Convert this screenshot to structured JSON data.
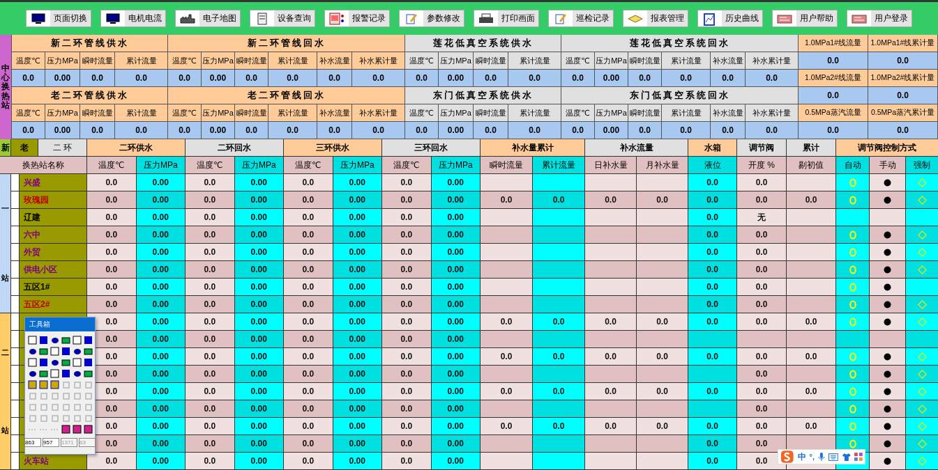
{
  "toolbar": {
    "buttons": [
      "页面切换",
      "电机电流",
      "电子地图",
      "设备查询",
      "报警记录",
      "参数修改",
      "打印画面",
      "巡检记录",
      "报表管理",
      "历史曲线",
      "用户帮助",
      "用户登录"
    ]
  },
  "top_panel": {
    "side_label": "中心换热站",
    "bands": [
      {
        "sections": [
          {
            "title": "新二环管线供水",
            "color": "#ffcc99",
            "columns": [
              "温度℃",
              "压力MPa",
              "瞬时流量",
              "累计流量"
            ],
            "values": [
              "0.0",
              "0.00",
              "0.0",
              "0.0"
            ]
          },
          {
            "title": "新二环管线回水",
            "color": "#ffcc99",
            "columns": [
              "温度℃",
              "压力MPa",
              "瞬时流量",
              "累计流量",
              "补水流量",
              "补水累计量"
            ],
            "values": [
              "0.0",
              "0.00",
              "0.0",
              "0.0",
              "0.0",
              "0.0"
            ]
          },
          {
            "title": "莲花低真空系统供水",
            "color": "#e0e0e0",
            "columns": [
              "温度℃",
              "压力MPa",
              "瞬时流量",
              "累计流量"
            ],
            "values": [
              "0.0",
              "0.00",
              "0.0",
              "0.0"
            ]
          },
          {
            "title": "莲花低真空系统回水",
            "color": "#e0e0e0",
            "columns": [
              "温度℃",
              "压力MPa",
              "瞬时流量",
              "累计流量",
              "补水流量",
              "补水累计量"
            ],
            "values": [
              "0.0",
              "0.00",
              "0.0",
              "0.0",
              "0.0",
              "0.0"
            ]
          }
        ]
      },
      {
        "sections": [
          {
            "title": "老二环管线供水",
            "color": "#ffcc99",
            "columns": [
              "温度℃",
              "压力MPa",
              "瞬时流量",
              "累计流量"
            ],
            "values": [
              "0.0",
              "0.00",
              "0.0",
              "0.0"
            ]
          },
          {
            "title": "老二环管线回水",
            "color": "#ffcc99",
            "columns": [
              "温度℃",
              "压力MPa",
              "瞬时流量",
              "累计流量",
              "补水流量",
              "补水累计量"
            ],
            "values": [
              "0.0",
              "0.00",
              "0.0",
              "0.0",
              "0.0",
              "0.0"
            ]
          },
          {
            "title": "东门低真空系统供水",
            "color": "#e0e0e0",
            "columns": [
              "温度℃",
              "压力MPa",
              "瞬时流量",
              "累计流量"
            ],
            "values": [
              "0.0",
              "0.00",
              "0.0",
              "0.0"
            ]
          },
          {
            "title": "东门低真空系统回水",
            "color": "#e0e0e0",
            "columns": [
              "温度℃",
              "压力MPa",
              "瞬时流量",
              "累计流量",
              "补水流量",
              "补水累计量"
            ],
            "values": [
              "0.0",
              "0.00",
              "0.0",
              "0.0",
              "0.0",
              "0.0"
            ]
          }
        ]
      }
    ],
    "extras": [
      {
        "labels": [
          "1.0MPa1#线流量",
          "1.0MPa1#线累计量"
        ],
        "values": [
          "0.0",
          "0.0"
        ]
      },
      {
        "labels": [
          "1.0MPa2#线流量",
          "1.0MPa2#线累计量"
        ],
        "values": [
          "0.0",
          "0.0"
        ]
      },
      {
        "labels": [
          "0.5MPa蒸汽流量",
          "0.5MPa蒸汽累计量"
        ],
        "values": [
          "0.0",
          "0.0"
        ]
      }
    ]
  },
  "station_table": {
    "ring_tabs": [
      {
        "label": "新",
        "color": "#99cc33"
      },
      {
        "label": "老",
        "color": "#999900"
      },
      {
        "label": "二 环",
        "color": "#e0e0e0"
      }
    ],
    "name_header": "换热站名称",
    "header_groups": [
      {
        "title": "二环供水",
        "color": "#ffcc99",
        "columns": [
          "温度℃",
          "压力MPa"
        ]
      },
      {
        "title": "二环回水",
        "color": "#e0e0e0",
        "columns": [
          "温度℃",
          "压力MPa"
        ]
      },
      {
        "title": "三环供水",
        "color": "#ffcc99",
        "columns": [
          "温度℃",
          "压力MPa"
        ]
      },
      {
        "title": "三环回水",
        "color": "#e0e0e0",
        "columns": [
          "温度℃",
          "压力MPa"
        ]
      },
      {
        "title": "补水量累计",
        "color": "#ffcc99",
        "columns": [
          "瞬时流量",
          "累计流量"
        ]
      },
      {
        "title": "补水流量",
        "color": "#e0e0e0",
        "columns": [
          "日补水量",
          "月补水量"
        ]
      },
      {
        "title": "水箱",
        "color": "#ffcc99",
        "columns": [
          "液位"
        ]
      },
      {
        "title": "调节阀",
        "color": "#e0e0e0",
        "columns": [
          "开度 %"
        ]
      },
      {
        "title": "累计",
        "color": "#e0e0e0",
        "columns": [
          "剔初值"
        ]
      },
      {
        "title": "调节阀控制方式",
        "color": "#ffcc99",
        "columns": [
          "自动",
          "手动",
          "强制"
        ]
      }
    ],
    "groups": [
      {
        "label_top": "一",
        "label_bottom": "站",
        "color": "#c0d8f8",
        "rows": [
          {
            "name": "兴盛",
            "color": "#800080",
            "readings": [
              "0.0",
              "0.00",
              "0.0",
              "0.00",
              "0.0",
              "0.00",
              "0.0",
              "0.00"
            ],
            "tank_level": "0.0",
            "valve_opening": "0.0",
            "auto": true,
            "manual": true,
            "forced": true
          },
          {
            "name": "玫瑰园",
            "color": "#c00000",
            "readings": [
              "0.0",
              "0.00",
              "0.0",
              "0.00",
              "0.0",
              "0.00",
              "0.0",
              "0.00"
            ],
            "makeup_instant": "0.0",
            "makeup_total": "0.0",
            "daily_makeup": "0.0",
            "monthly_makeup": "0.0",
            "tank_level": "0.0",
            "valve_opening": "0.0",
            "initial_value": "0.0",
            "auto": true,
            "manual": true,
            "forced": true
          },
          {
            "name": "辽建",
            "color": "#000000",
            "readings": [
              "0.0",
              "0.00",
              "0.0",
              "0.00",
              "0.0",
              "0.00",
              "0.0",
              "0.00"
            ],
            "tank_level": "0.0",
            "valve_opening": "无",
            "auto": false,
            "manual": false,
            "forced": false
          },
          {
            "name": "六中",
            "color": "#800080",
            "readings": [
              "0.0",
              "0.00",
              "0.0",
              "0.00",
              "0.0",
              "0.00",
              "0.0",
              "0.00"
            ],
            "tank_level": "0.0",
            "valve_opening": "0.0",
            "auto": true,
            "manual": true,
            "forced": true
          },
          {
            "name": "外贸",
            "color": "#800080",
            "readings": [
              "0.0",
              "0.00",
              "0.0",
              "0.00",
              "0.0",
              "0.00",
              "0.0",
              "0.00"
            ],
            "tank_level": "0.0",
            "valve_opening": "0.0",
            "auto": true,
            "manual": true,
            "forced": true
          },
          {
            "name": "供电小区",
            "color": "#800080",
            "readings": [
              "0.0",
              "0.00",
              "0.0",
              "0.00",
              "0.0",
              "0.00",
              "0.0",
              "0.00"
            ],
            "tank_level": "0.0",
            "valve_opening": "0.0",
            "auto": true,
            "manual": true,
            "forced": true
          },
          {
            "name": "五区1#",
            "color": "#000000",
            "readings": [
              "0.0",
              "0.00",
              "0.0",
              "0.00",
              "0.0",
              "0.00",
              "0.0",
              "0.00"
            ],
            "tank_level": "0.0",
            "valve_opening": "0.0",
            "auto": true,
            "manual": true,
            "forced": false
          },
          {
            "name": "五区2#",
            "color": "#c00000",
            "readings": [
              "0.0",
              "0.00",
              "0.0",
              "0.00",
              "0.0",
              "0.00",
              "0.0",
              "0.00"
            ],
            "tank_level": "0.0",
            "valve_opening": "0.0",
            "auto": true,
            "manual": true,
            "forced": true
          }
        ]
      },
      {
        "label_top": "二",
        "label_bottom": "站",
        "color": "#ffcc66",
        "rows": [
          {
            "readings": [
              "0.0",
              "0.00",
              "0.0",
              "0.00",
              "0.0",
              "0.00",
              "0.0",
              "0.00"
            ],
            "makeup_instant": "0.0",
            "makeup_total": "0.0",
            "daily_makeup": "0.0",
            "monthly_makeup": "0.0",
            "tank_level": "0.0",
            "valve_opening": "0.0",
            "initial_value": "0.0",
            "auto": true,
            "manual": true,
            "forced": true
          },
          {
            "readings": [
              "0.0",
              "0.00",
              "0.0",
              "0.00",
              "0.0",
              "0.00",
              "0.0",
              "0.00"
            ],
            "auto": false,
            "manual": false,
            "forced": false
          },
          {
            "readings": [
              "0.0",
              "0.00",
              "0.0",
              "0.00",
              "0.0",
              "0.00",
              "0.0",
              "0.00"
            ],
            "makeup_instant": "0.0",
            "makeup_total": "0.0",
            "daily_makeup": "0.0",
            "monthly_makeup": "0.0",
            "tank_level": "0.0",
            "valve_opening": "0.0",
            "initial_value": "0.0",
            "auto": true,
            "manual": true,
            "forced": true
          },
          {
            "readings": [
              "0.0",
              "0.00",
              "0.0",
              "0.00",
              "0.0",
              "0.00",
              "0.0",
              "0.00"
            ],
            "valve_opening": "0.0",
            "auto": true,
            "manual": true,
            "forced": true
          },
          {
            "readings": [
              "0.0",
              "0.00",
              "0.0",
              "0.00",
              "0.0",
              "0.00",
              "0.0",
              "0.00"
            ],
            "makeup_instant": "0.0",
            "makeup_total": "0.0",
            "daily_makeup": "0.0",
            "monthly_makeup": "0.0",
            "tank_level": "0.0",
            "valve_opening": "0.0",
            "initial_value": "0.0",
            "auto": true,
            "manual": true,
            "forced": true
          },
          {
            "readings": [
              "0.0",
              "0.00",
              "0.0",
              "0.00",
              "0.0",
              "0.00",
              "0.0",
              "0.00"
            ],
            "valve_opening": "0.0",
            "auto": true,
            "manual": true,
            "forced": true
          },
          {
            "readings": [
              "0.0",
              "0.00",
              "0.0",
              "0.00",
              "0.0",
              "0.00",
              "0.0",
              "0.00"
            ],
            "makeup_instant": "0.0",
            "makeup_total": "0.0",
            "daily_makeup": "0.0",
            "monthly_makeup": "0.0",
            "tank_level": "0.0",
            "valve_opening": "0.0",
            "initial_value": "0.0",
            "auto": true,
            "manual": true,
            "forced": true
          },
          {
            "readings": [
              "0.0",
              "0.00",
              "0.0",
              "0.00",
              "0.0",
              "0.00",
              "0.0",
              "0.00"
            ],
            "tank_level": "0.0",
            "valve_opening": "0.0",
            "auto": true,
            "manual": true,
            "forced": true
          },
          {
            "name": "火车站",
            "color": "#800080",
            "readings": [
              "0.0",
              "0.00",
              "0.0",
              "0.00",
              "0.0",
              "0.00",
              "0.0",
              "0.00"
            ],
            "tank_level": "0.0",
            "valve_opening": "0.0",
            "auto": false,
            "manual": true,
            "forced": true
          }
        ]
      }
    ]
  },
  "toolbox": {
    "title": "工具箱",
    "fields": [
      {
        "value": "863",
        "disabled": false
      },
      {
        "value": "957",
        "disabled": false
      },
      {
        "value": "1371",
        "disabled": true
      },
      {
        "value": "63",
        "disabled": true
      }
    ]
  },
  "ime_bar": {
    "mode": "中",
    "punctuation": "°,"
  }
}
